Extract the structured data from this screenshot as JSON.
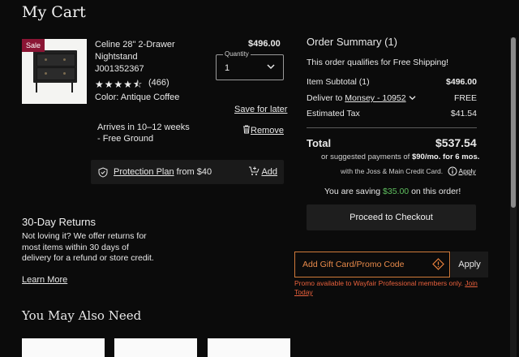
{
  "page": {
    "title": "My Cart"
  },
  "product": {
    "sale_badge": "Sale",
    "name_line1": "Celine 28\" 2-Drawer",
    "name_line2": "Nightstand",
    "sku": "J001352367",
    "rating": 4.5,
    "stars": "★★★★⯪",
    "review_count": "(466)",
    "color": "Color: Antique Coffee",
    "price": "$496.00",
    "quantity_label": "Quantity",
    "quantity": "1",
    "save_for_later": "Save for later",
    "remove": "Remove",
    "arrives_line1": "Arrives in 10–12 weeks",
    "arrives_line2": "- Free Ground"
  },
  "protection": {
    "link": "Protection Plan",
    "price_text": "from $40",
    "add": "Add"
  },
  "returns": {
    "heading": "30-Day Returns",
    "text": "Not loving it? We offer returns for most items within 30 days of delivery for a refund or store credit.",
    "learn_more": "Learn More"
  },
  "also_need": {
    "heading": "You May Also Need"
  },
  "summary": {
    "heading": "Order Summary (1)",
    "free_shipping": "This order qualifies for Free Shipping!",
    "subtotal_label": "Item Subtotal (1)",
    "subtotal_value": "$496.00",
    "deliver_prefix": "Deliver to",
    "deliver_location": "Monsey - 10952",
    "deliver_value": "FREE",
    "tax_label": "Estimated Tax",
    "tax_value": "$41.54",
    "total_label": "Total",
    "total_value": "$537.54",
    "suggested_prefix": "or suggested payments of",
    "suggested_amount": "$90/mo. for 6 mos.",
    "credit_card_text": "with the Joss & Main Credit Card.",
    "credit_apply": "Apply",
    "saving_prefix": "You are saving",
    "saving_amount": "$35.00",
    "saving_suffix": "on this order!",
    "checkout": "Proceed to Checkout"
  },
  "promo": {
    "placeholder": "Add Gift Card/Promo Code",
    "apply": "Apply",
    "note_text": "Promo available to Wayfair Professional members only.",
    "note_link": "Join Today"
  },
  "colors": {
    "sale": "#8a1534",
    "saving": "#5fbf5f",
    "promo": "#e8603c"
  }
}
